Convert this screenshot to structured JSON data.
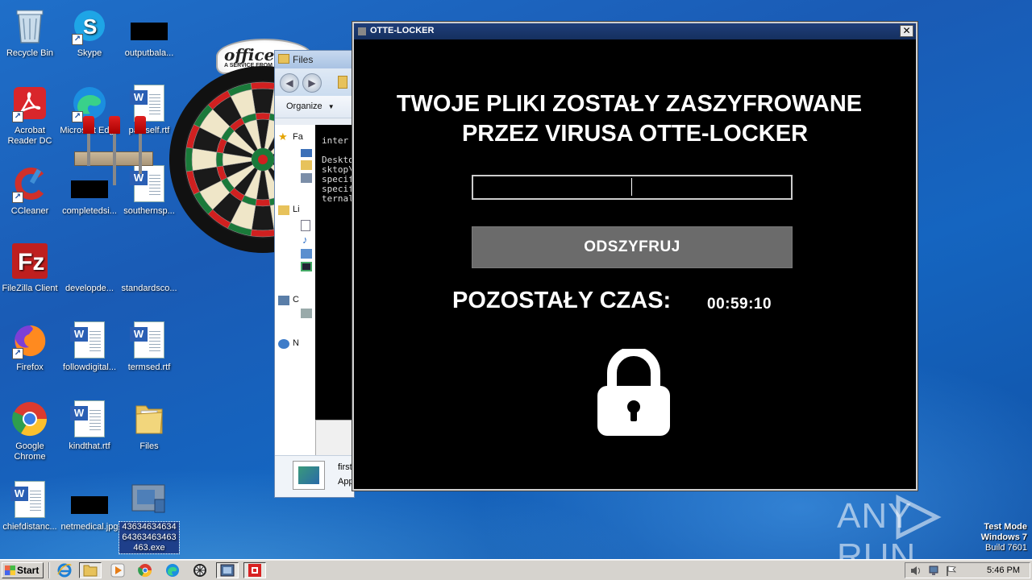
{
  "desktop": {
    "icons": [
      {
        "id": "recycle",
        "label": "Recycle Bin"
      },
      {
        "id": "skype",
        "label": "Skype"
      },
      {
        "id": "outputbala",
        "label": "outputbala..."
      },
      {
        "id": "acrobat",
        "label": "Acrobat Reader DC"
      },
      {
        "id": "edge",
        "label": "Microsoft Edge"
      },
      {
        "id": "patitself",
        "label": "patitself.rtf"
      },
      {
        "id": "ccleaner",
        "label": "CCleaner"
      },
      {
        "id": "completedsi",
        "label": "completedsi..."
      },
      {
        "id": "southernsp",
        "label": "southernsp..."
      },
      {
        "id": "filezilla",
        "label": "FileZilla Client"
      },
      {
        "id": "developde",
        "label": "developde..."
      },
      {
        "id": "standardsco",
        "label": "standardsco..."
      },
      {
        "id": "firefox",
        "label": "Firefox"
      },
      {
        "id": "followdigital",
        "label": "followdigital..."
      },
      {
        "id": "termsed",
        "label": "termsed.rtf"
      },
      {
        "id": "chrome",
        "label": "Google Chrome"
      },
      {
        "id": "kindthat",
        "label": "kindthat.rtf"
      },
      {
        "id": "files",
        "label": "Files"
      },
      {
        "id": "chiefdistanc",
        "label": "chiefdistanc..."
      },
      {
        "id": "netmedical",
        "label": "netmedical.jpg"
      },
      {
        "id": "exe",
        "label": "43634634634 64363463463 463.exe"
      }
    ]
  },
  "explorer": {
    "title": "Files",
    "organize_label": "Organize",
    "sidebar": [
      "Fa",
      "Li",
      "C",
      "N"
    ],
    "cmd_lines": [
      "inter",
      "",
      "Deskto",
      "sktop\\",
      "specif",
      "specif",
      "ternal"
    ],
    "status_name": "first",
    "status_type": "App"
  },
  "office_widget": {
    "brand": "office",
    "tagline": "A SERVICE FROM"
  },
  "ransom_window": {
    "title": "OTTE-LOCKER",
    "close_glyph": "✕",
    "heading_line1": "TWOJE PLIKI ZOSTAŁY ZASZYFROWANE",
    "heading_line2": "PRZEZ VIRUSA OTTE-LOCKER",
    "key_input_value": "",
    "decrypt_button": "ODSZYFRUJ",
    "timer_label": "POZOSTAŁY CZAS:",
    "timer_value": "00:59:10"
  },
  "watermark": {
    "text": "ANY RUN"
  },
  "os_badge": {
    "line1": "Test Mode",
    "line2": "Windows 7",
    "line3": "Build 7601"
  },
  "taskbar": {
    "start_label": "Start",
    "clock": "5:46 PM",
    "pinned": [
      "ie-icon",
      "explorer-icon",
      "media-player-icon",
      "chrome-icon",
      "edge-icon",
      "avast-icon",
      "app-window-icon",
      "otte-locker-icon"
    ]
  },
  "colors": {
    "desktop_blue": "#1a5bb5",
    "ransom_bg": "#000000",
    "decrypt_button": "#6b6b6b",
    "ransom_titlebar": "#1f3e7a"
  }
}
